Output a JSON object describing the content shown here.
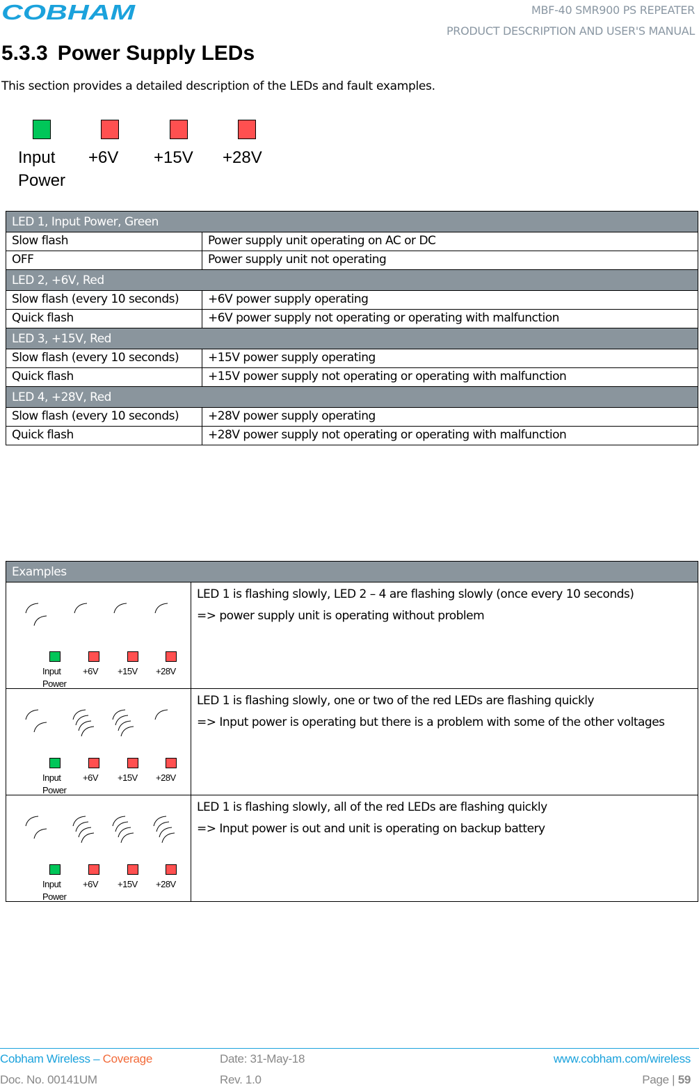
{
  "header": {
    "logo_text": "COBHAM",
    "logo_color": "#1BA2DC",
    "doc_title_line1": "MBF-40 SMR900 PS REPEATER",
    "doc_title_line2": "PRODUCT DESCRIPTION AND USER'S MANUAL"
  },
  "section": {
    "number": "5.3.3",
    "title": "Power Supply LEDs",
    "intro": "This section provides a detailed description of the LEDs and fault examples."
  },
  "led_panel": {
    "leds": [
      {
        "label_line1": "Input",
        "label_line2": "Power",
        "color": "green"
      },
      {
        "label_line1": "+6V",
        "label_line2": "",
        "color": "red"
      },
      {
        "label_line1": "+15V",
        "label_line2": "",
        "color": "red"
      },
      {
        "label_line1": "+28V",
        "label_line2": "",
        "color": "red"
      }
    ],
    "colors": {
      "green": "#00C659",
      "red": "#FF5050"
    }
  },
  "led_table": {
    "sections": [
      {
        "heading": "LED 1, Input Power, Green",
        "rows": [
          {
            "state": "Slow flash",
            "meaning": "Power supply unit operating on AC or DC"
          },
          {
            "state": "OFF",
            "meaning": "Power supply unit not operating"
          }
        ]
      },
      {
        "heading": "LED 2, +6V, Red",
        "rows": [
          {
            "state": "Slow flash (every 10 seconds)",
            "meaning": "+6V power supply operating"
          },
          {
            "state": "Quick flash",
            "meaning": "+6V power supply not operating or operating with malfunction"
          }
        ]
      },
      {
        "heading": "LED 3, +15V, Red",
        "rows": [
          {
            "state": "Slow flash (every 10 seconds)",
            "meaning": "+15V power supply operating"
          },
          {
            "state": "Quick flash",
            "meaning": "+15V power supply not operating or operating with malfunction"
          }
        ]
      },
      {
        "heading": "LED 4, +28V, Red",
        "rows": [
          {
            "state": "Slow flash (every 10 seconds)",
            "meaning": "+28V power supply operating"
          },
          {
            "state": "Quick flash",
            "meaning": "+28V power supply not operating or operating with malfunction"
          }
        ]
      }
    ]
  },
  "examples": {
    "heading": "Examples",
    "items": [
      {
        "flash": [
          "slow",
          "slow",
          "slow",
          "slow"
        ],
        "line1": "LED 1 is flashing slowly, LED 2 – 4 are flashing slowly (once every 10 seconds)",
        "line2": "=> power supply unit is operating without problem"
      },
      {
        "flash": [
          "slow",
          "quick",
          "quick",
          "slow"
        ],
        "line1": "LED 1 is flashing slowly, one or two of  the red LEDs are flashing quickly",
        "line2": "=> Input power is operating but there is a problem with some of the other voltages"
      },
      {
        "flash": [
          "slow",
          "quick",
          "quick",
          "quick"
        ],
        "line1": "LED 1 is flashing slowly, all of  the red LEDs are flashing quickly",
        "line2": "=> Input power is out and unit is operating on backup battery"
      }
    ]
  },
  "footer": {
    "company": "Cobham Wireless",
    "dash": " – ",
    "division": "Coverage",
    "date": "Date: 31-May-18",
    "website": "www.cobham.com/wireless",
    "doc_no": "Doc. No. 00141UM",
    "rev": "Rev. 1.0",
    "page_label": "Page | ",
    "page_number": "59"
  }
}
